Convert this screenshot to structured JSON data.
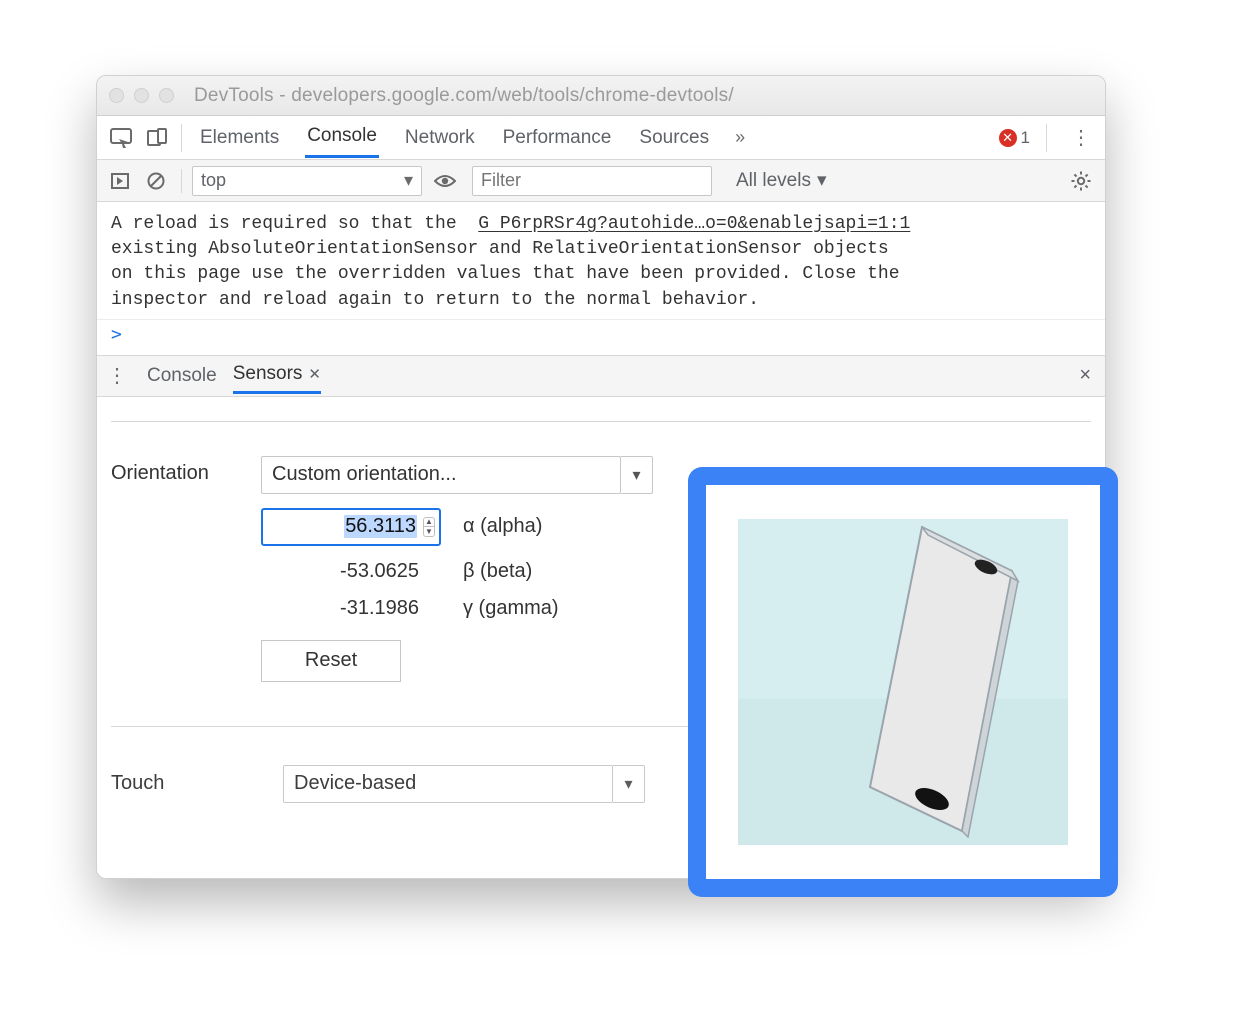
{
  "window": {
    "title": "DevTools - developers.google.com/web/tools/chrome-devtools/"
  },
  "tabs": {
    "items": [
      "Elements",
      "Console",
      "Network",
      "Performance",
      "Sources"
    ],
    "active_index": 1,
    "overflow_glyph": "»",
    "error_count": "1"
  },
  "console_toolbar": {
    "context": "top",
    "filter_placeholder": "Filter",
    "levels_label": "All levels"
  },
  "console": {
    "message_main": "A reload is required so that the\nexisting AbsoluteOrientationSensor and RelativeOrientationSensor objects\non this page use the overridden values that have been provided. Close the\ninspector and reload again to return to the normal behavior.",
    "message_source": "G P6rpRSr4g?autohide…o=0&enablejsapi=1:1",
    "prompt": ">"
  },
  "drawer": {
    "tabs": [
      "Console",
      "Sensors"
    ],
    "active_index": 1,
    "close_glyph": "×"
  },
  "sensors": {
    "orientation": {
      "label": "Orientation",
      "preset": "Custom orientation...",
      "alpha": {
        "value": "56.3113",
        "label": "α (alpha)"
      },
      "beta": {
        "value": "-53.0625",
        "label": "β (beta)"
      },
      "gamma": {
        "value": "-31.1986",
        "label": "γ (gamma)"
      },
      "reset_label": "Reset"
    },
    "touch": {
      "label": "Touch",
      "preset": "Device-based"
    }
  }
}
